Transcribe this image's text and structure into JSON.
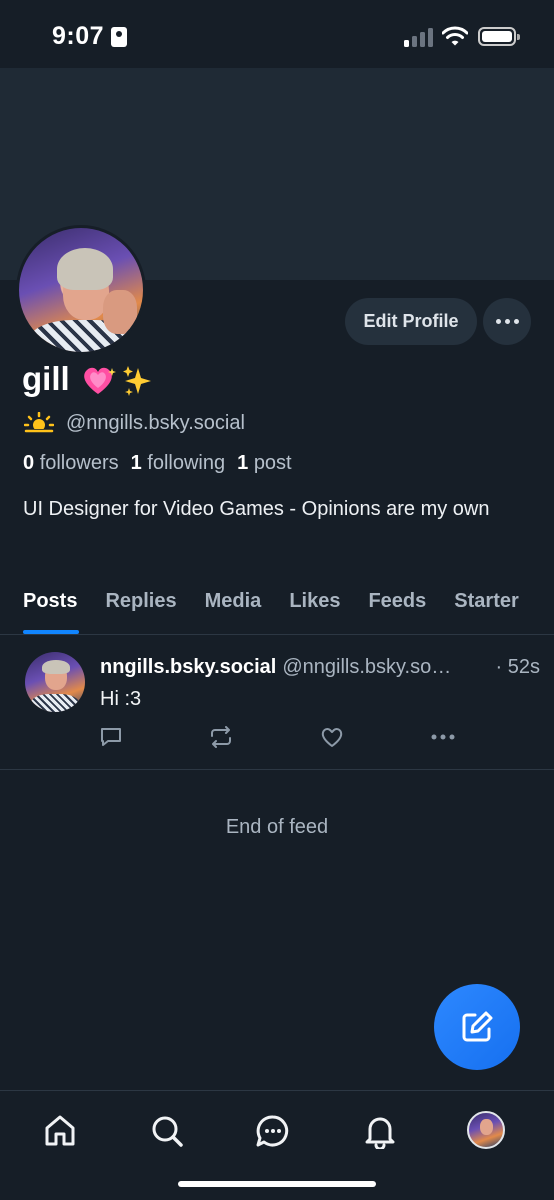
{
  "status_bar": {
    "time": "9:07"
  },
  "profile": {
    "display_name": "gill",
    "name_emojis": "💖 ✨",
    "handle_emoji": "⛅",
    "handle": "@nngills.bsky.social",
    "followers_count": "0",
    "followers_label": "followers",
    "following_count": "1",
    "following_label": "following",
    "posts_count": "1",
    "posts_label": "post",
    "bio": "UI Designer for Video Games - Opinions are my own",
    "edit_profile_label": "Edit Profile"
  },
  "tabs": [
    {
      "label": "Posts",
      "active": true
    },
    {
      "label": "Replies"
    },
    {
      "label": "Media"
    },
    {
      "label": "Likes"
    },
    {
      "label": "Feeds"
    },
    {
      "label": "Starter"
    }
  ],
  "post": {
    "author_name": "nngills.bsky.social",
    "author_handle": "@nngills.bsky.social",
    "timestamp": "· 52s",
    "text": "Hi :3"
  },
  "feed": {
    "end_label": "End of feed"
  },
  "colors": {
    "background": "#161e27",
    "banner": "#1f2a35",
    "accent": "#1185fe",
    "fab": "#2d88ff",
    "muted_text": "#aab5c1"
  },
  "icons": {
    "nav": [
      "home-icon",
      "search-icon",
      "chat-icon",
      "bell-icon",
      "avatar"
    ],
    "post_actions": [
      "reply-icon",
      "repost-icon",
      "like-icon",
      "more-icon"
    ],
    "fab": "compose-icon"
  }
}
